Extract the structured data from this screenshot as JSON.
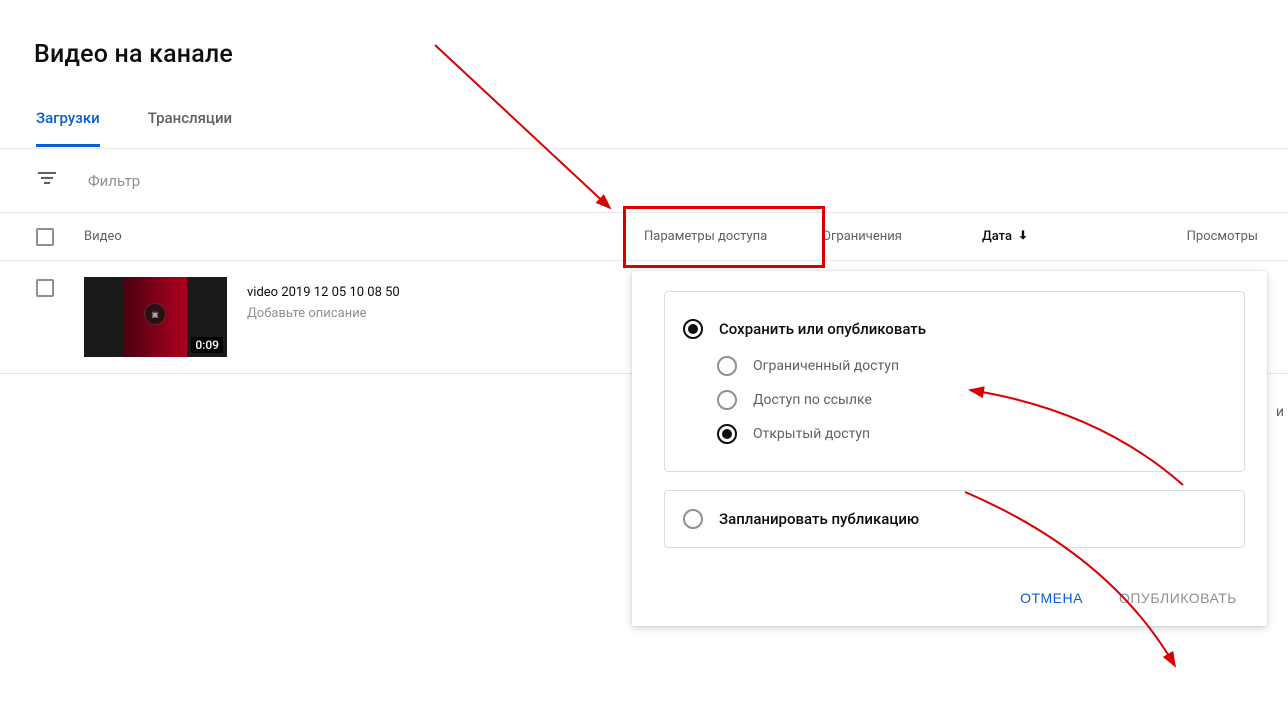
{
  "page": {
    "title": "Видео на канале"
  },
  "tabs": {
    "uploads": "Загрузки",
    "live": "Трансляции"
  },
  "filter": {
    "placeholder": "Фильтр"
  },
  "columns": {
    "video": "Видео",
    "visibility": "Параметры доступа",
    "restrictions": "Ограничения",
    "date": "Дата",
    "views": "Просмотры"
  },
  "video": {
    "title": "video 2019 12 05 10 08 50",
    "description_placeholder": "Добавьте описание",
    "duration": "0:09"
  },
  "popup": {
    "save_or_publish": "Сохранить или опубликовать",
    "private": "Ограниченный доступ",
    "unlisted": "Доступ по ссылке",
    "public": "Открытый доступ",
    "schedule": "Запланировать публикацию",
    "cancel": "ОТМЕНА",
    "publish": "ОПУБЛИКОВАТЬ"
  },
  "side_char": "и"
}
